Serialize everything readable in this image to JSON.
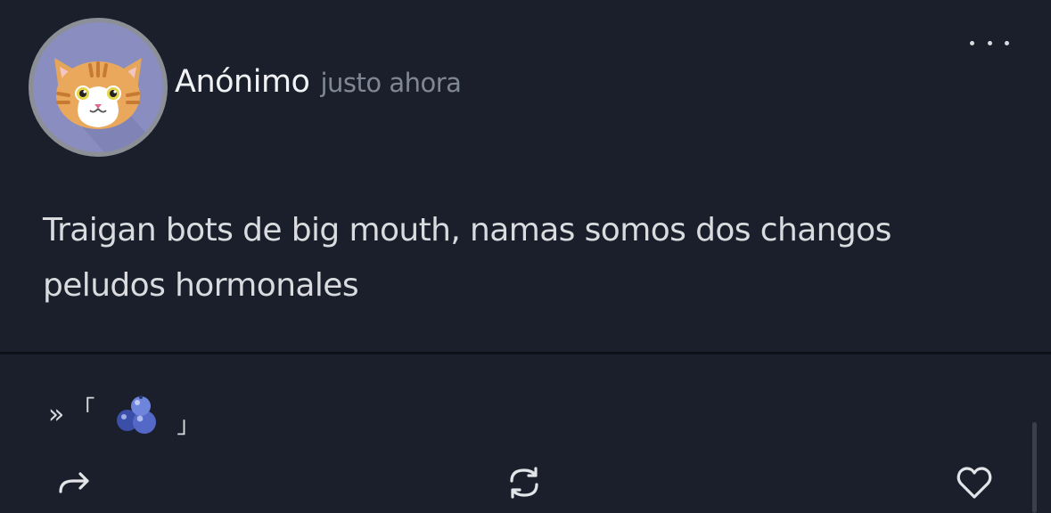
{
  "author": {
    "name": "Anónimo",
    "timestamp": "justo ahora",
    "avatar_icon": "cat-face-icon"
  },
  "post": {
    "text": "Traigan bots de big mouth, namas somos dos changos peludos hormonales"
  },
  "signature": {
    "prefix": "»",
    "open_bracket": "「",
    "emoji": "blueberries-icon",
    "close_bracket": "」"
  },
  "actions": {
    "share_icon": "share-arrow-icon",
    "repost_icon": "repost-icon",
    "like_icon": "heart-icon",
    "more_icon": "more-dots-icon"
  },
  "colors": {
    "background": "#1a1f2b",
    "avatar_bg": "#8a8dbf",
    "text": "#d9dbdf",
    "muted": "#7f8794"
  }
}
